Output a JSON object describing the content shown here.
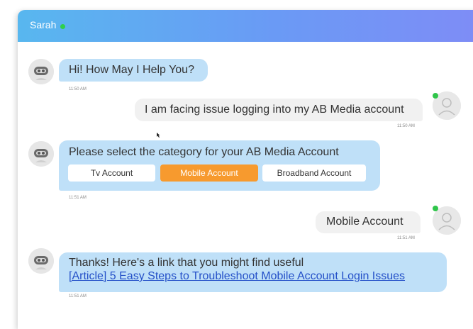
{
  "header": {
    "name": "Sarah",
    "status_color": "#2fd04a"
  },
  "messages": [
    {
      "sender": "bot",
      "text": "Hi! How May I Help You?",
      "time": "11:50 AM"
    },
    {
      "sender": "user",
      "text": "I am facing issue logging into my AB Media account",
      "time": "11:50 AM"
    },
    {
      "sender": "bot",
      "text": "Please select the category for your AB Media Account",
      "time": "11:51 AM",
      "options": [
        "Tv Account",
        "Mobile Account",
        "Broadband Account"
      ],
      "selected_option": "Mobile Account"
    },
    {
      "sender": "user",
      "text": "Mobile Account",
      "time": "11:51 AM"
    },
    {
      "sender": "bot",
      "text": "Thanks! Here's a link that you might find useful",
      "link": "[Article] 5 Easy Steps to Troubleshoot Mobile Account Login Issues",
      "time": "11:51 AM"
    }
  ],
  "icons": {
    "bot_avatar": "robot-icon",
    "user_avatar": "user-silhouette-icon",
    "cursor": "mouse-pointer-icon"
  },
  "colors": {
    "header_gradient_start": "#58b7ef",
    "header_gradient_end": "#7f8cf6",
    "bot_bubble": "#bfe0f8",
    "user_bubble": "#f1f1f1",
    "selected_option": "#f79a2e",
    "link": "#2450c8"
  }
}
